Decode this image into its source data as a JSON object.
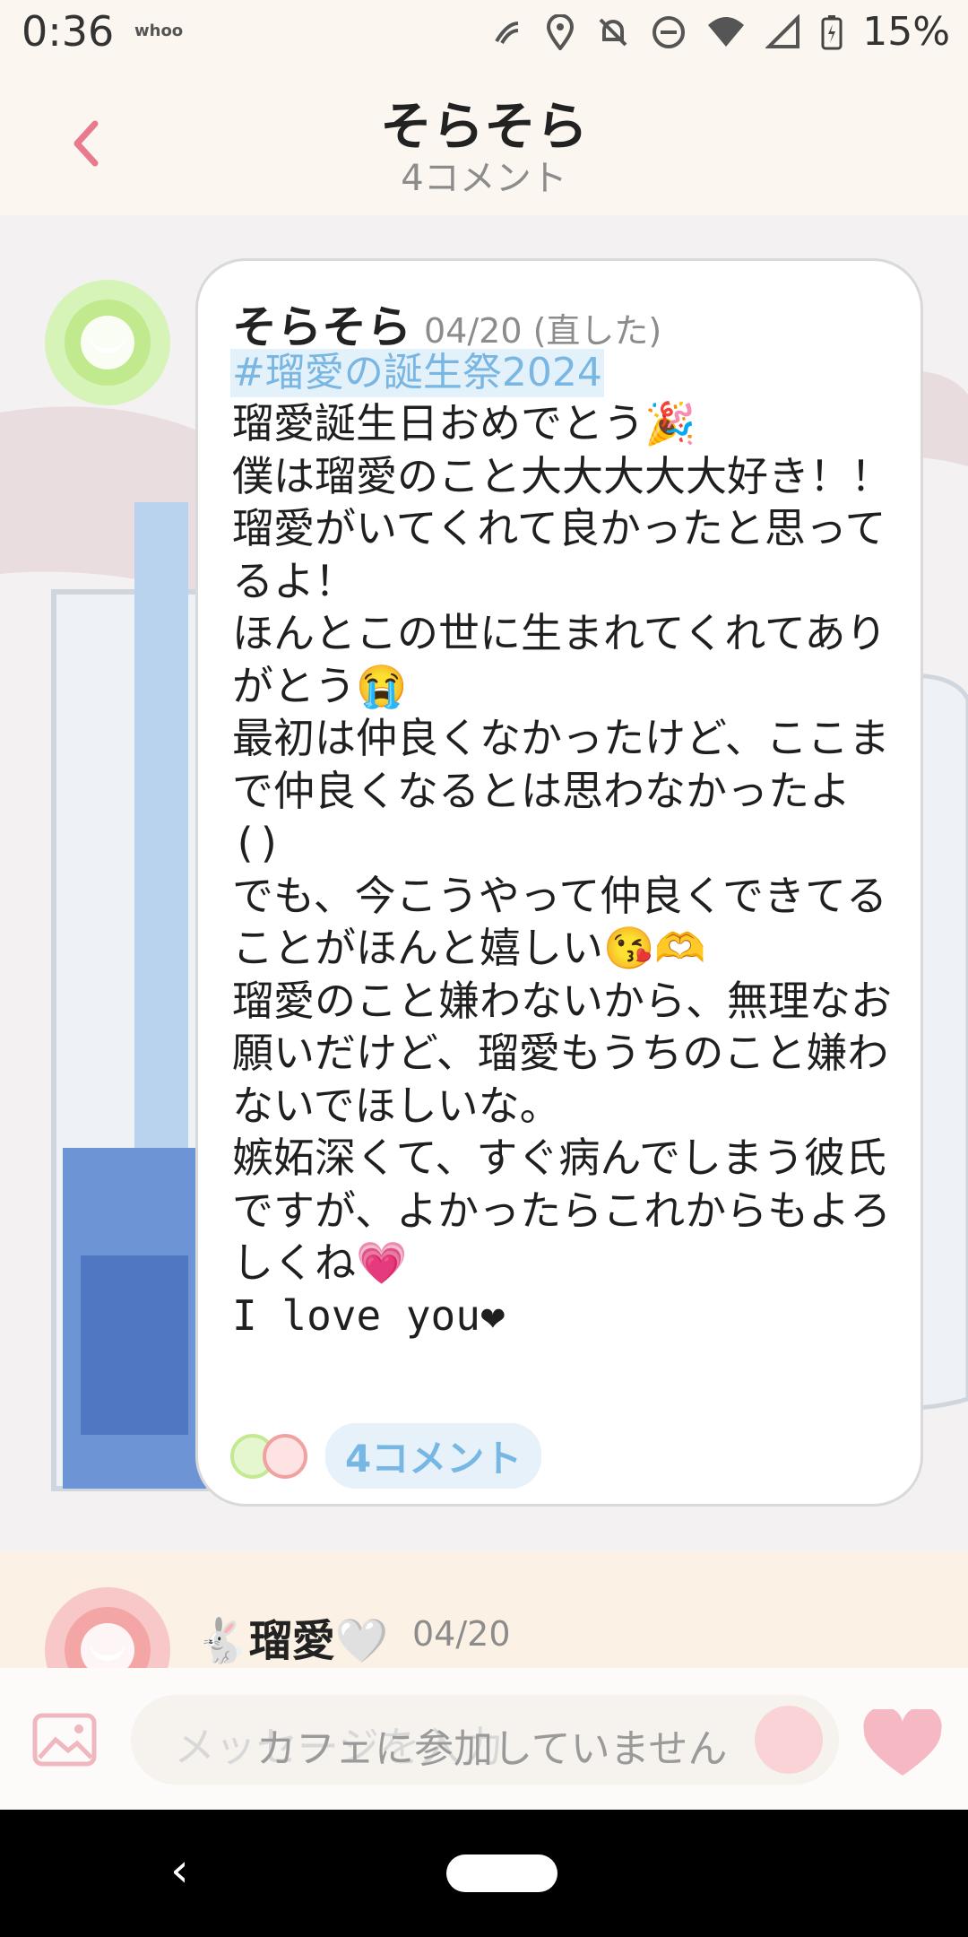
{
  "status_bar": {
    "time": "0:36",
    "app": "whoo",
    "battery": "15%",
    "icons": [
      "nfc-icon",
      "location-icon",
      "bell-off-icon",
      "dnd-icon",
      "wifi-icon",
      "signal-icon",
      "battery-icon"
    ]
  },
  "header": {
    "title": "そらそら",
    "subtitle": "4コメント"
  },
  "post": {
    "author": "そらそら",
    "date": "04/20 (直した)",
    "hashtag": "#瑠愛の誕生祭2024",
    "body": "瑠愛誕生日おめでとう🎉\n僕は瑠愛のこと大大大大大好き！！\n瑠愛がいてくれて良かったと思ってるよ！\nほんとこの世に生まれてくれてありがとう😭\n最初は仲良くなかったけど、ここまで仲良くなるとは思わなかったよ()\nでも、今こうやって仲良くできてることがほんと嬉しい😘🫶\n瑠愛のこと嫌わないから、無理なお願いだけど、瑠愛もうちのこと嫌わないでほしいな。\n嫉妬深くて、すぐ病んでしまう彼氏ですが、よかったらこれからもよろしくね💗\nI love you❤",
    "comment_count": "4コメント"
  },
  "next_comment": {
    "author": "🐇瑠愛🤍",
    "date": "04/20"
  },
  "input": {
    "placeholder": "メッセージを入力",
    "status": "カフェに参加していません"
  },
  "colors": {
    "accent_pink": "#e87a8e",
    "hashtag_blue": "#79b6e2",
    "avatar_green": "#c1ea8f",
    "heart_pink": "#f6b8c2"
  }
}
